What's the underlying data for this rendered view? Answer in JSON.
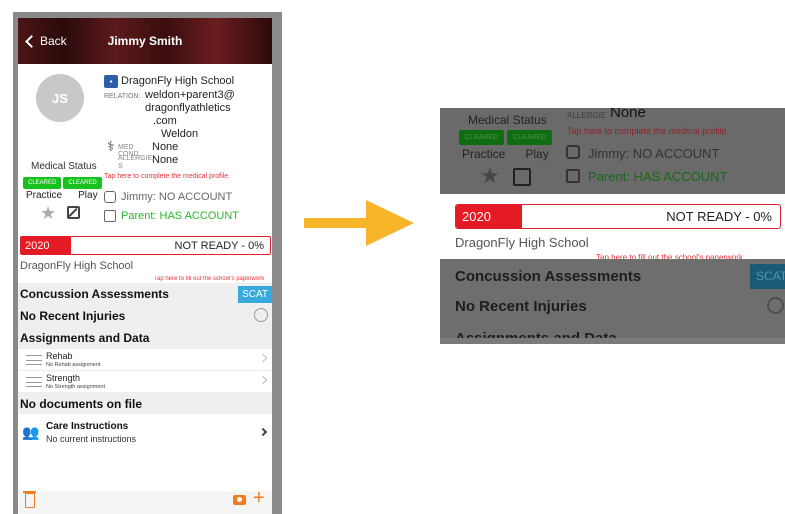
{
  "phone": {
    "nav": {
      "back_label": "Back",
      "title": "Jimmy Smith"
    },
    "avatar_initials": "JS",
    "school": "DragonFly High School",
    "relation_label": "RELATION:",
    "relation_lines": [
      "weldon+parent3@",
      "dragonflyathletics",
      ".com",
      "Weldon"
    ],
    "med_cond_label": "MED COND.",
    "med_cond_value": "None",
    "allergies_label": "ALLERGIE S",
    "allergies_value": "None",
    "tap_medical": "Tap here to complete the medical profile.",
    "medical_status_label": "Medical Status",
    "badge_practice": "CLEARED",
    "badge_play": "CLEARED",
    "practice_label": "Practice",
    "play_label": "Play",
    "jimmy_account": "Jimmy: NO ACCOUNT",
    "parent_account": "Parent: HAS ACCOUNT",
    "year": "2020",
    "readiness": "NOT READY - 0%",
    "readiness_fraction": 0.0,
    "school_line": "DragonFly High School",
    "tap_paperwork": "Tap here to fill out the school's paperwork",
    "concussion_title": "Concussion Assessments",
    "scat_label": "SCAT",
    "injuries_title": "No Recent Injuries",
    "assignments_title": "Assignments and Data",
    "assignments": [
      {
        "title": "Rehab",
        "sub": "No Rehab assignment"
      },
      {
        "title": "Strength",
        "sub": "No Strength assignment"
      }
    ],
    "docs_title": "No documents on file",
    "care_title": "Care Instructions",
    "care_sub": "No current instructions"
  },
  "zoom": {
    "medical_status_label": "Medical Status",
    "allergies_label": "ALLERGIE",
    "allergies_value": "None",
    "tap_medical": "Tap here to complete the medical profile.",
    "badge_practice": "CLEARED",
    "badge_play": "CLEARED",
    "practice_label": "Practice",
    "play_label": "Play",
    "jimmy_account": "Jimmy: NO ACCOUNT",
    "parent_account": "Parent: HAS ACCOUNT",
    "year": "2020",
    "readiness": "NOT READY - 0%",
    "school_line": "DragonFly High School",
    "tap_paperwork": "Tap here to fill out the school's paperwork",
    "concussion_title": "Concussion Assessments",
    "scat_label": "SCAT",
    "injuries_title": "No Recent Injuries",
    "assignments_title": "Assignments and Data"
  },
  "colors": {
    "accent_red": "#e51a22",
    "cleared_green": "#18c21e",
    "parent_green": "#29b729",
    "scat_blue": "#37a9dd",
    "action_orange": "#f07b20",
    "arrow_yellow": "#f7b52a"
  },
  "icons": [
    "back-chevron-icon",
    "school-icon",
    "caduceus-icon",
    "star-icon",
    "edit-icon",
    "phone-icon",
    "timer-icon",
    "menu-lines-icon",
    "care-people-icon",
    "trash-icon",
    "camera-icon",
    "plus-icon",
    "arrow-icon"
  ]
}
